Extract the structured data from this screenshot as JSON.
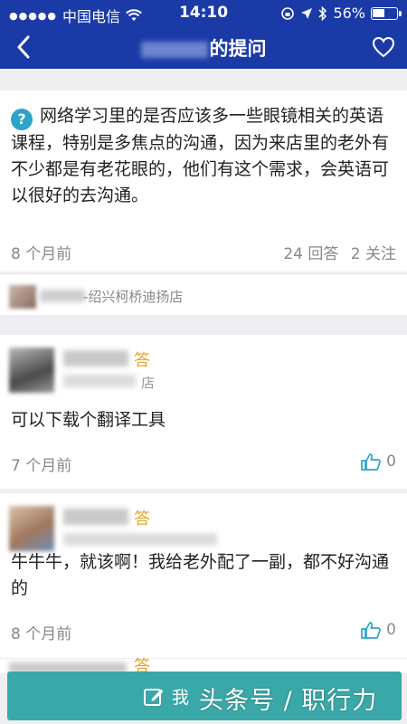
{
  "status_bar": {
    "signal_dots": "●●●●●",
    "carrier": "中国电信",
    "time": "14:10",
    "battery_percent": "56%",
    "battery_level": 0.56
  },
  "nav": {
    "title_suffix": "的提问"
  },
  "question": {
    "text": "网络学习里的是否应该多一些眼镜相关的英语课程，特别是多焦点的沟通，因为来店里的老外有不少都是有老花眼的，他们有这个需求，会英语可以很好的去沟通。",
    "time": "8 个月前",
    "answers": "24 回答",
    "follows": "2 关注",
    "asker_store": "-绍兴柯桥迪扬店"
  },
  "answers": [
    {
      "label": "答",
      "sub": "店",
      "content": "可以下载个翻译工具",
      "time": "7 个月前",
      "likes": "0"
    },
    {
      "label": "答",
      "sub": "",
      "content": "牛牛牛，就该啊！我给老外配了一副，都不好沟通的",
      "time": "8 个月前",
      "likes": "0"
    }
  ],
  "peek_answer": {
    "label": "答"
  },
  "bottom": {
    "button_label": "我",
    "watermark": "头条号 / 职行力"
  },
  "colors": {
    "header": "#1a3aa8",
    "accent": "#e8a32a",
    "bottom_button": "#3aa8a8",
    "like_icon": "#2aa5c8"
  }
}
